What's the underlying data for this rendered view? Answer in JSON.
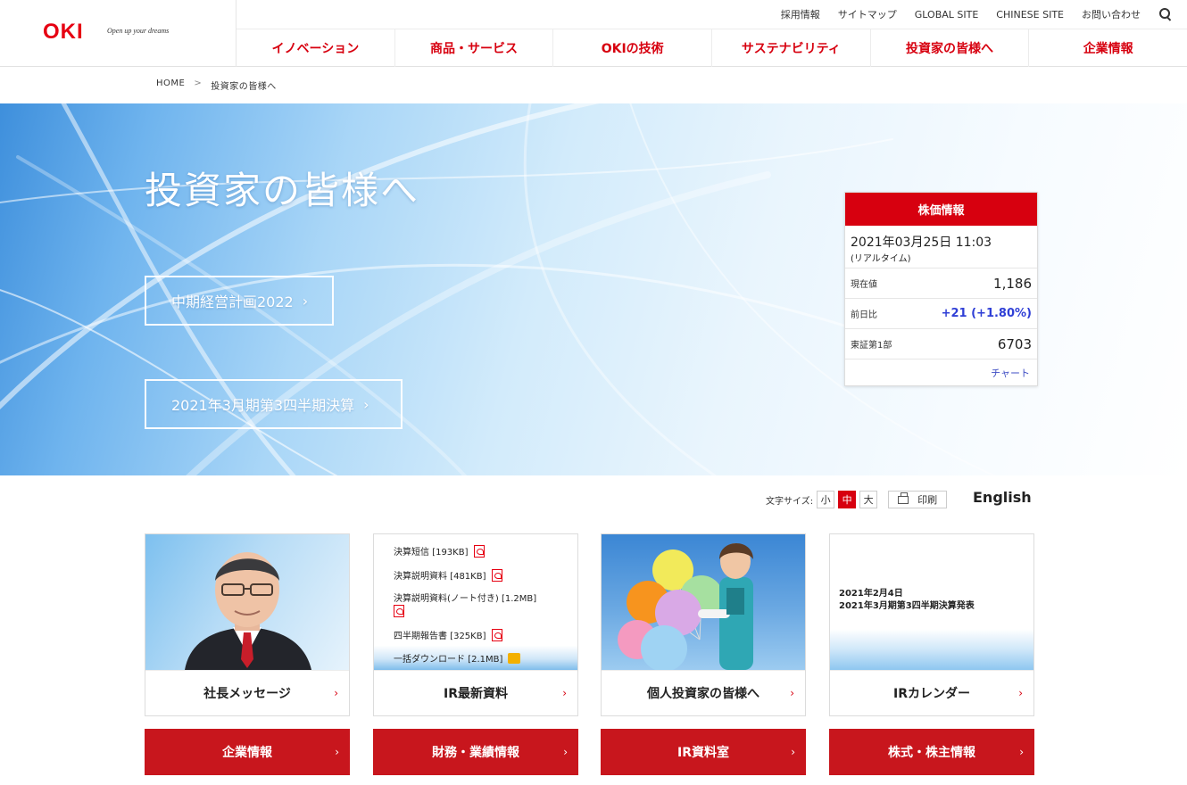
{
  "header": {
    "logo": "OKI",
    "tagline": "Open up your dreams",
    "utility_nav": [
      "採用情報",
      "サイトマップ",
      "GLOBAL SITE",
      "CHINESE SITE",
      "お問い合わせ"
    ],
    "main_nav": [
      "イノベーション",
      "商品・サービス",
      "OKIの技術",
      "サステナビリティ",
      "投資家の皆様へ",
      "企業情報"
    ]
  },
  "breadcrumb": {
    "home": "HOME",
    "separator": ">",
    "current": "投資家の皆様へ"
  },
  "hero": {
    "title": "投資家の皆様へ",
    "buttons": [
      "中期経営計画2022",
      "2021年3月期第3四半期決算"
    ]
  },
  "stock": {
    "heading": "株価情報",
    "datetime": "2021年03月25日 11:03",
    "realtime_note": "(リアルタイム)",
    "rows": [
      {
        "label": "現在値",
        "value": "1,186"
      },
      {
        "label": "前日比",
        "value": "+21 (+1.80%)"
      },
      {
        "label": "東証第1部",
        "value": "6703"
      }
    ],
    "chart_link": "チャート"
  },
  "tools": {
    "font_size_label": "文字サイズ:",
    "sizes": [
      "小",
      "中",
      "大"
    ],
    "active_size": "中",
    "print_label": "印刷",
    "english": "English"
  },
  "cards": [
    {
      "label": "社長メッセージ"
    },
    {
      "label": "IR最新資料",
      "documents": [
        "決算短信 [193KB]",
        "決算説明資料 [481KB]",
        "決算説明資料(ノート付き) [1.2MB]",
        "四半期報告書 [325KB]",
        "一括ダウンロード [2.1MB]"
      ]
    },
    {
      "label": "個人投資家の皆様へ"
    },
    {
      "label": "IRカレンダー",
      "date": "2021年2月4日",
      "event": "2021年3月期第3四半期決算発表"
    }
  ],
  "red_buttons": [
    "企業情報",
    "財務・業績情報",
    "IR資料室",
    "株式・株主情報"
  ],
  "colors": {
    "brand_red": "#d7000f",
    "button_red": "#c8161d",
    "link_blue": "#2f3fd6"
  }
}
